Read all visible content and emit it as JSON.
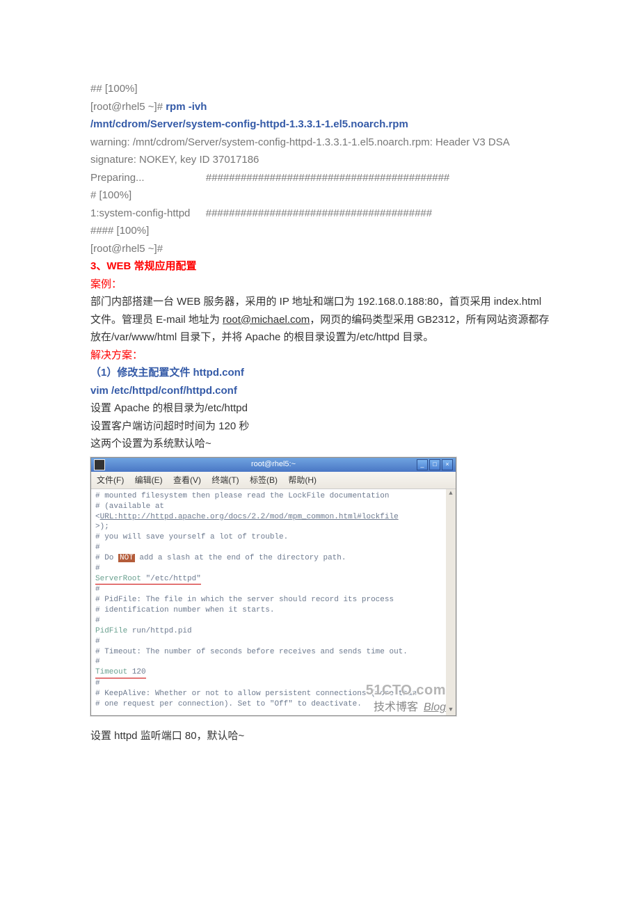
{
  "pre_terminal": {
    "line1": "## [100%]",
    "line2_prefix": "[root@rhel5 ~]# ",
    "line2_cmd": "rpm -ivh",
    "line3_cmd": "/mnt/cdrom/Server/system-config-httpd-1.3.3.1-1.el5.noarch.rpm",
    "line4": "warning: /mnt/cdrom/Server/system-config-httpd-1.3.3.1-1.el5.noarch.rpm: Header V3 DSA signature: NOKEY, key ID 37017186",
    "line5a": "Preparing...",
    "line5b": "##########################################",
    "line6": "# [100%]",
    "line7a": "   1:system-config-httpd",
    "line7b": "#######################################",
    "line8": "#### [100%]",
    "line9": "[root@rhel5 ~]#"
  },
  "section": {
    "heading": "3、WEB 常规应用配置",
    "case_label": "案例：",
    "desc_part1": "部门内部搭建一台 WEB 服务器，采用的 IP 地址和端口为 192.168.0.188:80，首页采用 index.html 文件。管理员 E-mail 地址为 ",
    "desc_email": "root@michael.com",
    "desc_part2": "，网页的编码类型采用 GB2312，所有网站资源都存放在/var/www/html 目录下，并将 Apache 的根目录设置为/etc/httpd 目录。",
    "solution_label": "解决方案：",
    "step1_label": "（1）修改主配置文件 httpd.conf",
    "step1_cmd": "vim /etc/httpd/conf/httpd.conf",
    "s1_line1": "设置 Apache 的根目录为/etc/httpd",
    "s1_line2": "设置客户端访问超时时间为 120 秒",
    "s1_line3": "这两个设置为系统默认哈~"
  },
  "terminal": {
    "title": "root@rhel5:~",
    "menu": {
      "file": "文件(F)",
      "edit": "编辑(E)",
      "view": "查看(V)",
      "terminal": "终端(T)",
      "tabs": "标签(B)",
      "help": "帮助(H)"
    },
    "body": {
      "l1": "# mounted filesystem then please read the LockFile documentation",
      "l2a": "# (available at <",
      "l2b": "URL:http://httpd.apache.org/docs/2.2/mod/mpm_common.html#lockfile",
      "l2c": ">);",
      "l3": "# you will save yourself a lot of trouble.",
      "l4": "#",
      "l5a": "# Do ",
      "l5b": "NOT",
      "l5c": " add a slash at the end of the directory path.",
      "l6": "#",
      "l7a": "ServerRoot ",
      "l7b": "\"/etc/httpd\"",
      "l8": " ",
      "l9": "#",
      "l10": "# PidFile: The file in which the server should record its process",
      "l11": "# identification number when it starts.",
      "l12": "#",
      "l13a": "PidFile ",
      "l13b": "run/httpd.pid",
      "l14": " ",
      "l15": "#",
      "l16": "# Timeout: The number of seconds before receives and sends time out.",
      "l17": "#",
      "l18a": "Timeout ",
      "l18b": "120",
      "l19": " ",
      "l20": "#",
      "l21": "# KeepAlive: Whether or not to allow persistent connections (more than",
      "l22": "# one request per connection). Set to \"Off\" to deactivate."
    },
    "watermark": {
      "top": "51CTO.com",
      "bottom_cn": "技术博客",
      "bottom_en": "Blog"
    }
  },
  "post_terminal": {
    "line1": "设置 httpd 监听端口 80，默认哈~"
  }
}
